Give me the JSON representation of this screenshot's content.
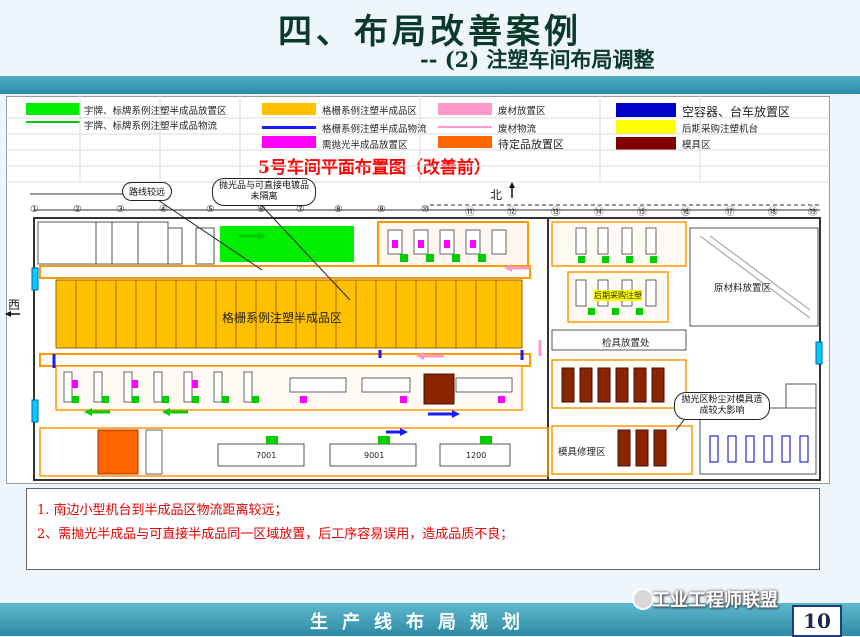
{
  "slide": {
    "title": "四、布局改善案例",
    "subtitle": "-- (2) 注塑车间布局调整",
    "footer": "生产线布局规划",
    "page_number": "10",
    "watermark": "工业工程师联盟"
  },
  "legend": [
    {
      "label": "宇牌、标牌系例注塑半成品放置区",
      "color": "#00ee00",
      "kind": "area"
    },
    {
      "label": "宇牌、标牌系例注塑半成品物流",
      "color": "#00cc00",
      "kind": "arrow"
    },
    {
      "label": "格栅系例注塑半成品区",
      "color": "#ffc000",
      "kind": "area"
    },
    {
      "label": "格栅系例注塑半成品物流",
      "color": "#1a1aff",
      "kind": "arrow"
    },
    {
      "label": "废材放置区",
      "color": "#ff99cc",
      "kind": "area"
    },
    {
      "label": "废材物流",
      "color": "#ff99cc",
      "kind": "arrow"
    },
    {
      "label": "空容器、台车放置区",
      "color": "#0000cc",
      "kind": "area"
    },
    {
      "label": "后期采购注塑机台",
      "color": "#ffff00",
      "kind": "area"
    },
    {
      "label": "需抛光半成品放置区",
      "color": "#ff00ff",
      "kind": "area"
    },
    {
      "label": "待定品放置区",
      "color": "#ff6600",
      "kind": "area"
    },
    {
      "label": "模具区",
      "color": "#800000",
      "kind": "area"
    }
  ],
  "plan": {
    "title": "5号车间平面布置图（改善前）",
    "north": "北",
    "west": "西",
    "columns": [
      "①",
      "②",
      "③",
      "④",
      "⑤",
      "⑥",
      "⑦",
      "⑧",
      "⑨",
      "⑩",
      "⑪",
      "⑫",
      "⑬",
      "⑭",
      "⑮",
      "⑯",
      "⑰",
      "⑱",
      "⑲"
    ],
    "callouts": {
      "distance": "路线较远",
      "polish": "抛光品与可直接电镀品未隔离",
      "inspect": "抛光区粉尘对模具造成较大影响"
    },
    "areas": {
      "grille_zone": "格栅系例注塑半成品区",
      "raw_material": "原材料放置区",
      "inspection_left": "检具放置处",
      "mold_repair": "模具修理区",
      "machines_right": "后期采购注塑",
      "mach_7001": "7001",
      "mach_9001": "9001",
      "mach_1200": "1200"
    }
  },
  "notes": [
    "1.  南边小型机台到半成品区物流距离较远；",
    "2、需抛光半成品与可直接半成品同一区域放置，后工序容易误用，造成品质不良；"
  ]
}
